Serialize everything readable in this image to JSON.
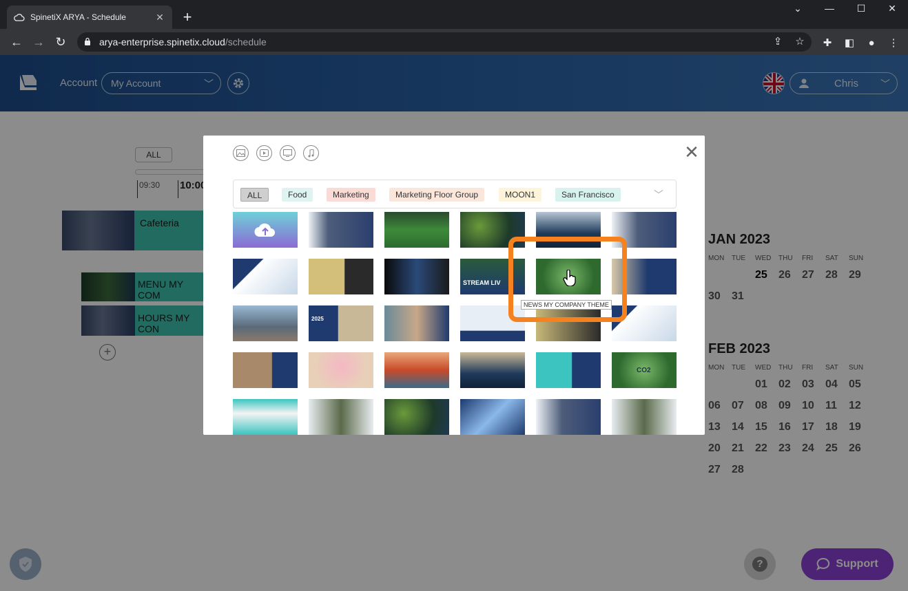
{
  "browser": {
    "tab_title": "SpinetiX ARYA - Schedule",
    "url_domain": "arya-enterprise.spinetix.cloud",
    "url_path": "/schedule"
  },
  "header": {
    "account_label": "Account",
    "account_value": "My Account",
    "user_name": "Chris"
  },
  "schedule": {
    "all_label": "ALL",
    "time_start": "09:30",
    "time_next": "10:00",
    "items": [
      {
        "label": "Cafeteria"
      },
      {
        "label": "MENU MY COM"
      },
      {
        "label": "HOURS MY CON"
      }
    ]
  },
  "modal": {
    "filters": [
      {
        "label": "ALL",
        "color": "#cfcfcf"
      },
      {
        "label": "Food",
        "color": "#dff4f0"
      },
      {
        "label": "Marketing",
        "color": "#fadbd6"
      },
      {
        "label": "Marketing Floor Group",
        "color": "#fbe6dc"
      },
      {
        "label": "MOON1",
        "color": "#fdf4d9"
      },
      {
        "label": "San Francisco",
        "color": "#d8f3ee"
      }
    ],
    "tooltip": "NEWS MY COMPANY THEME",
    "thumb_captions": {
      "stream": "STREAM LIV",
      "year": "2025",
      "co2": "CO2"
    }
  },
  "calendar": {
    "months": [
      {
        "title": "JAN 2023",
        "dow": [
          "MON",
          "TUE",
          "WED",
          "THU",
          "FRI",
          "SAT",
          "SUN"
        ],
        "days": [
          "",
          "",
          "25",
          "26",
          "27",
          "28",
          "29",
          "30",
          "31"
        ]
      },
      {
        "title": "FEB 2023",
        "dow": [
          "MON",
          "TUE",
          "WED",
          "THU",
          "FRI",
          "SAT",
          "SUN"
        ],
        "days": [
          "",
          "",
          "01",
          "02",
          "03",
          "04",
          "05",
          "06",
          "07",
          "08",
          "09",
          "10",
          "11",
          "12",
          "13",
          "14",
          "15",
          "16",
          "17",
          "18",
          "19",
          "20",
          "21",
          "22",
          "23",
          "24",
          "25",
          "26",
          "27",
          "28"
        ]
      }
    ]
  },
  "support_label": "Support"
}
